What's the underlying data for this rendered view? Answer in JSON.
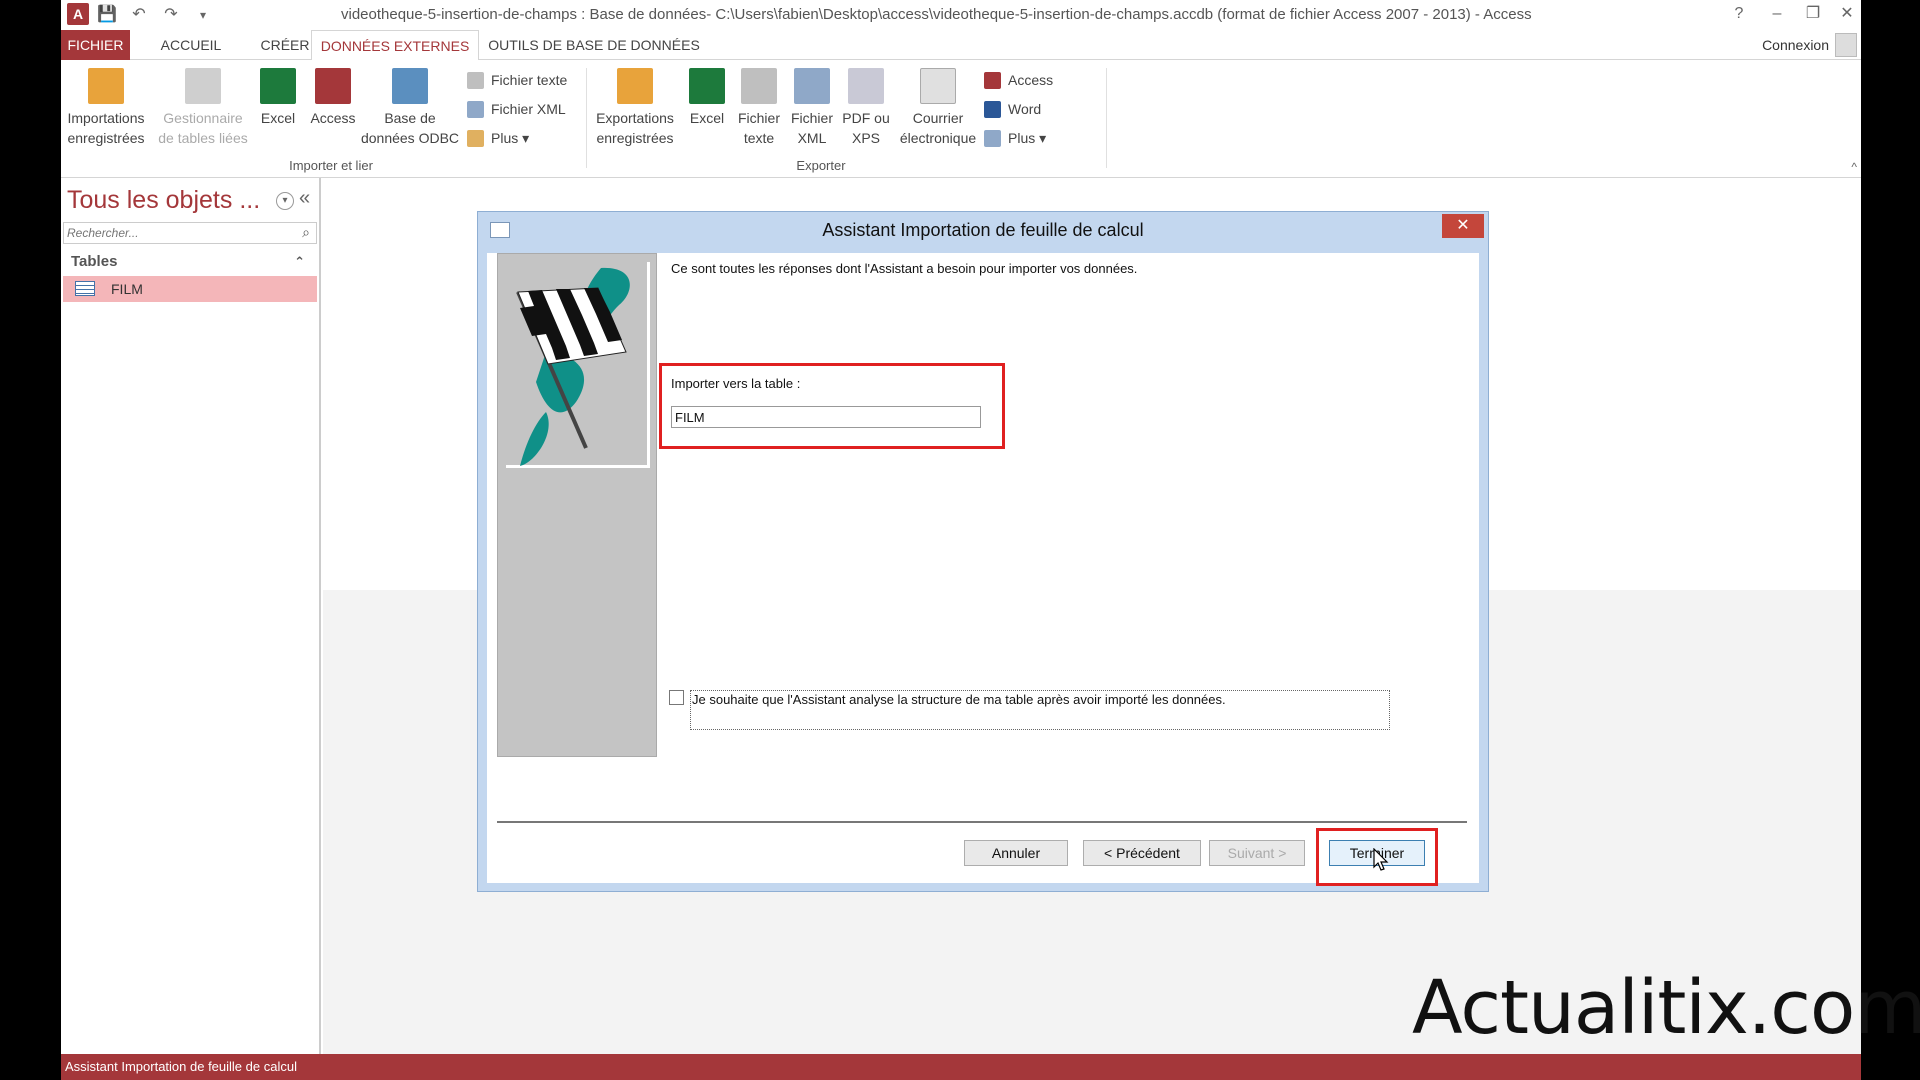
{
  "window": {
    "title": "videotheque-5-insertion-de-champs : Base de données- C:\\Users\\fabien\\Desktop\\access\\videotheque-5-insertion-de-champs.accdb (format de fichier Access 2007 - 2013) - Access",
    "help": "?",
    "minimize": "–",
    "restore": "❐",
    "close": "✕",
    "app_logo": "A"
  },
  "qat": {
    "save": "💾",
    "undo": "↶",
    "redo": "↷",
    "customize": "▾"
  },
  "tabs": {
    "fichier": "FICHIER",
    "accueil": "ACCUEIL",
    "creer": "CRÉER",
    "donnees_externes": "DONNÉES EXTERNES",
    "outils": "OUTILS DE BASE DE DONNÉES",
    "connexion": "Connexion"
  },
  "ribbon": {
    "import": {
      "group_label": "Importer et lier",
      "saved_imports": "Importations enregistrées",
      "linked_table_manager": "Gestionnaire de tables liées",
      "excel": "Excel",
      "access": "Access",
      "odbc": "Base de données ODBC",
      "text_file": "Fichier texte",
      "xml_file": "Fichier XML",
      "more": "Plus ▾"
    },
    "export": {
      "group_label": "Exporter",
      "saved_exports": "Exportations enregistrées",
      "excel": "Excel",
      "text_file": "Fichier texte",
      "xml_file": "Fichier XML",
      "pdf_xps": "PDF ou XPS",
      "email": "Courrier électronique",
      "access": "Access",
      "word": "Word",
      "more": "Plus ▾"
    },
    "collapse": "^"
  },
  "nav": {
    "title": "Tous les objets ...",
    "collapse": "«",
    "search_placeholder": "Rechercher...",
    "group": "Tables",
    "group_toggle": "⌃",
    "items": [
      {
        "label": "FILM"
      }
    ]
  },
  "dialog": {
    "title": "Assistant Importation de feuille de calcul",
    "close": "✕",
    "intro": "Ce sont toutes les réponses dont l'Assistant a besoin pour importer vos données.",
    "import_label": "Importer vers la table :",
    "import_value": "FILM",
    "analyze_label": "Je souhaite que l'Assistant analyse la structure de ma table après avoir importé les données.",
    "buttons": {
      "cancel": "Annuler",
      "previous": "< Précédent",
      "next": "Suivant >",
      "finish": "Terminer"
    }
  },
  "statusbar": {
    "text": "Assistant Importation de feuille de calcul"
  },
  "watermark": "Actualitix.com",
  "colors": {
    "accent": "#a4373a",
    "highlight": "#e02020",
    "dialog_frame": "#c3d7ef",
    "nav_selected": "#f4b6b9"
  }
}
